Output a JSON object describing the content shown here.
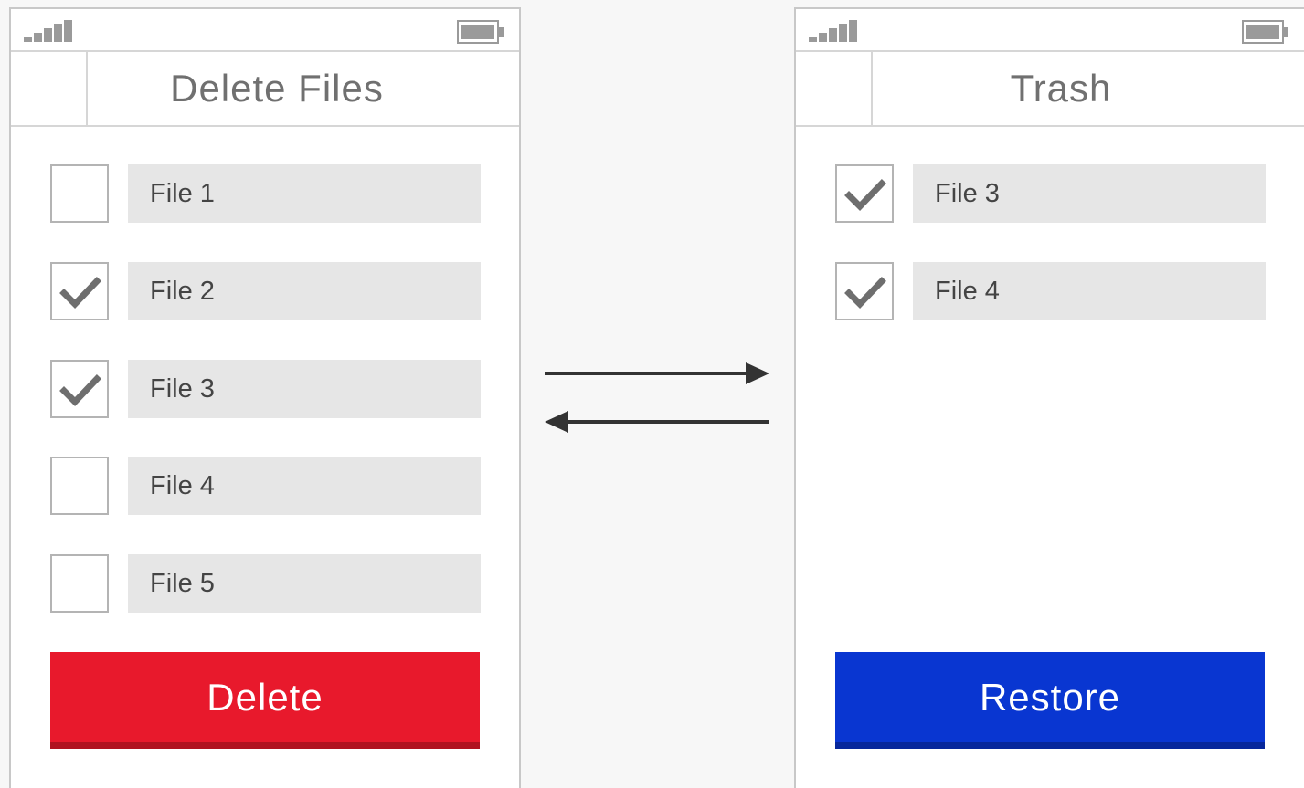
{
  "delete_screen": {
    "title": "Delete Files",
    "files": [
      {
        "label": "File 1",
        "checked": false
      },
      {
        "label": "File 2",
        "checked": true
      },
      {
        "label": "File 3",
        "checked": true
      },
      {
        "label": "File 4",
        "checked": false
      },
      {
        "label": "File 5",
        "checked": false
      }
    ],
    "action_label": "Delete"
  },
  "trash_screen": {
    "title": "Trash",
    "files": [
      {
        "label": "File 3",
        "checked": true
      },
      {
        "label": "File 4",
        "checked": true
      }
    ],
    "action_label": "Restore"
  },
  "icons": {
    "status_left": "signal-strength-icon",
    "status_right": "battery-icon",
    "checkmark": "checkmark-icon",
    "transfer_right": "arrow-right-icon",
    "transfer_left": "arrow-left-icon"
  },
  "colors": {
    "delete": "#e8192c",
    "restore": "#0936d1",
    "field": "#e6e6e6",
    "check": "#6e6e6e"
  }
}
